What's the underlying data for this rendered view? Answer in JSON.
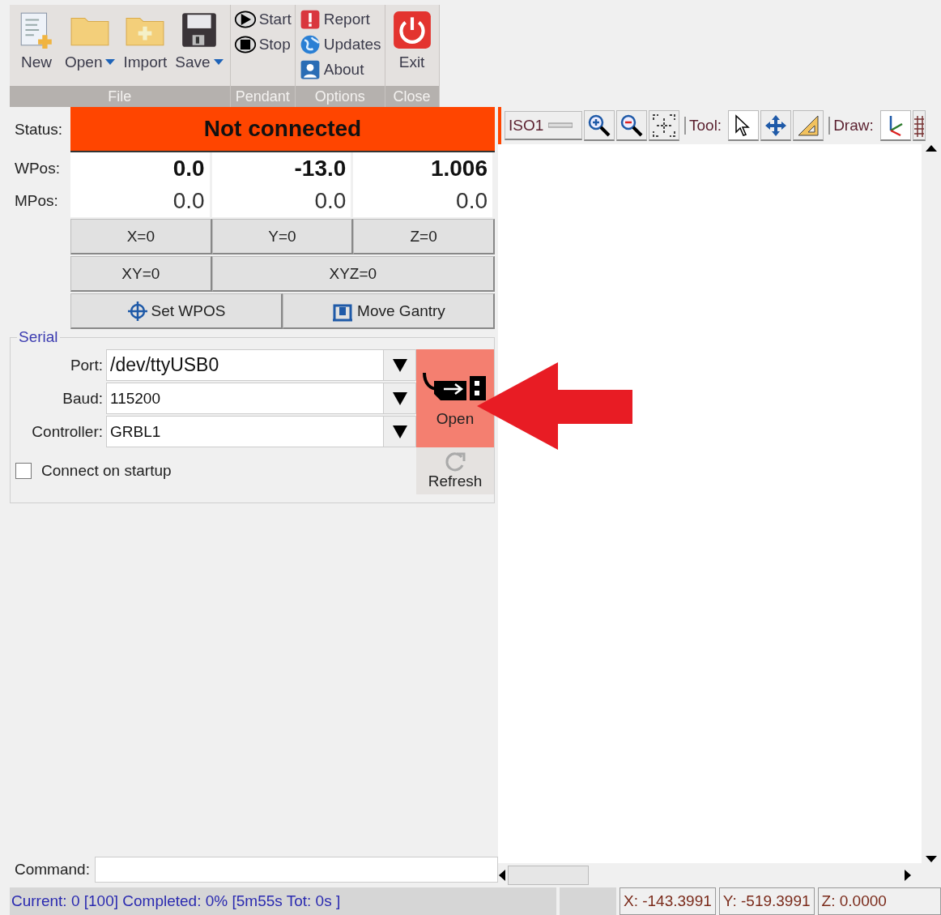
{
  "ribbon": {
    "groups": [
      {
        "label": "File",
        "kind": "large",
        "buttons": [
          {
            "label": "New",
            "kind": "new",
            "has_menu": false
          },
          {
            "label": "Open",
            "kind": "open",
            "has_menu": true
          },
          {
            "label": "Import",
            "kind": "import",
            "has_menu": false
          },
          {
            "label": "Save",
            "kind": "save",
            "has_menu": true
          }
        ]
      },
      {
        "label": "Pendant",
        "kind": "small",
        "buttons": [
          {
            "label": "Start",
            "kind": "start",
            "has_menu": false
          },
          {
            "label": "Stop",
            "kind": "stop",
            "has_menu": false
          }
        ]
      },
      {
        "label": "Options",
        "kind": "small",
        "buttons": [
          {
            "label": "Report",
            "kind": "report",
            "has_menu": false
          },
          {
            "label": "Updates",
            "kind": "updates",
            "has_menu": false
          },
          {
            "label": "About",
            "kind": "about",
            "has_menu": false
          }
        ]
      },
      {
        "label": "Close",
        "kind": "large",
        "buttons": [
          {
            "label": "Exit",
            "kind": "exit",
            "has_menu": false
          }
        ]
      }
    ]
  },
  "status": {
    "label": "Status:",
    "value": "Not connected",
    "connected": false
  },
  "positions": [
    {
      "label": "WPos:",
      "kind": "work",
      "values": [
        "0.0",
        "-13.0",
        "1.006"
      ]
    },
    {
      "label": "MPos:",
      "kind": "machine",
      "values": [
        "0.0",
        "0.0",
        "0.0"
      ]
    }
  ],
  "zero_buttons": [
    [
      {
        "label": "X=0"
      },
      {
        "label": "Y=0"
      },
      {
        "label": "Z=0"
      }
    ],
    [
      {
        "label": "XY=0"
      },
      {
        "label": "XYZ=0"
      }
    ],
    [
      {
        "label": "Set WPOS",
        "kind": "target"
      },
      {
        "label": "Move Gantry",
        "kind": "gantry"
      }
    ]
  ],
  "serial": {
    "title": "Serial",
    "fields": [
      {
        "label": "Port:",
        "value": "/dev/ttyUSB0"
      },
      {
        "label": "Baud:",
        "value": "115200"
      },
      {
        "label": "Controller:",
        "value": "GRBL1"
      }
    ],
    "open_button": "Open",
    "refresh_button": "Refresh",
    "startup_checkbox": {
      "label": "Connect on startup",
      "checked": false
    }
  },
  "command": {
    "label": "Command:"
  },
  "canvas_toolbar": {
    "view": "ISO1",
    "tool_label": "Tool:",
    "tools": [
      {
        "kind": "select",
        "selected": true
      },
      {
        "kind": "pan",
        "selected": false
      },
      {
        "kind": "ruler",
        "selected": false
      }
    ],
    "draw_label": "Draw:",
    "draw_items": [
      {
        "kind": "axes",
        "selected": true
      },
      {
        "kind": "grid",
        "selected": false
      }
    ]
  },
  "status_bar": {
    "progress": "Current: 0 [100]  Completed: 0% [5m55s Tot: 0s ]",
    "x": "X: -143.3991",
    "y": "Y: -519.3991",
    "z": "Z: 0.0000"
  }
}
